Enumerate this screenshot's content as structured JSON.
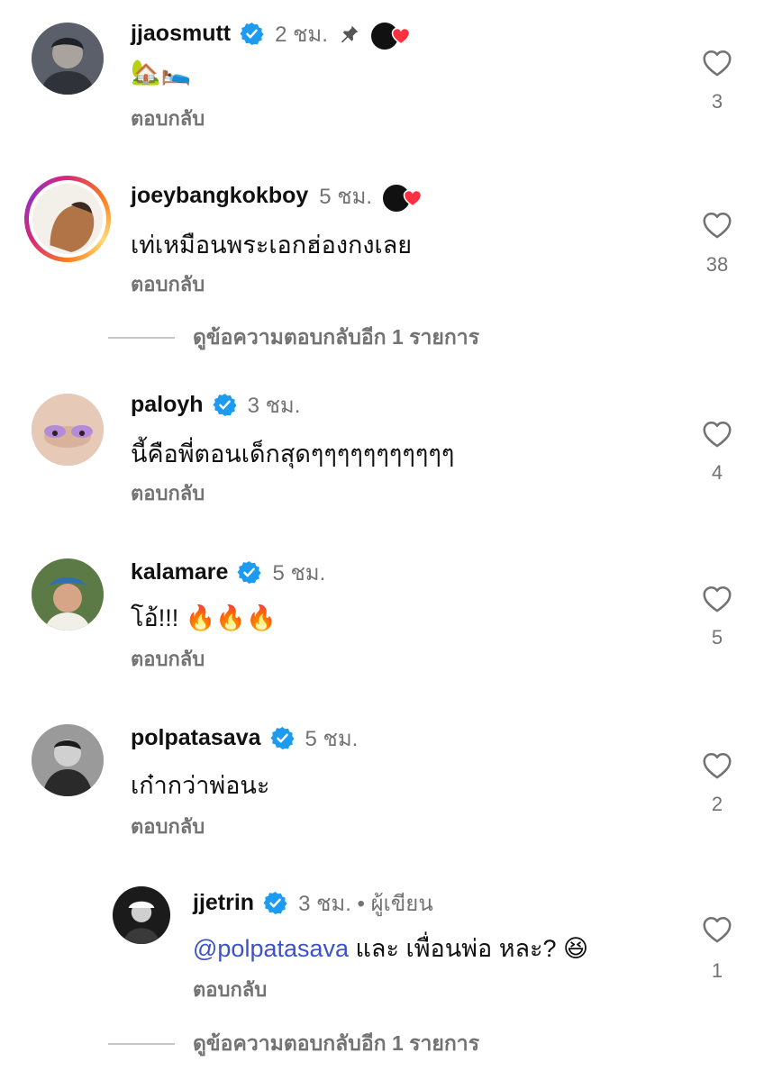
{
  "comments": [
    {
      "username": "jjaosmutt",
      "time": "2 ชม.",
      "text": "🏡🛌",
      "reply_label": "ตอบกลับ",
      "likes": "3"
    },
    {
      "username": "joeybangkokboy",
      "time": "5 ชม.",
      "text": "เท่เหมือนพระเอกฮ่องกงเลย",
      "reply_label": "ตอบกลับ",
      "likes": "38",
      "view_more": "ดูข้อความตอบกลับอีก 1 รายการ"
    },
    {
      "username": "paloyh",
      "time": "3 ชม.",
      "text": "นี้คือพี่ตอนเด็กสุดๆๆๆๆๆๆๆๆๆๆๆ",
      "reply_label": "ตอบกลับ",
      "likes": "4"
    },
    {
      "username": "kalamare",
      "time": "5 ชม.",
      "text": "โอ้!!! 🔥🔥🔥",
      "reply_label": "ตอบกลับ",
      "likes": "5"
    },
    {
      "username": "polpatasava",
      "time": "5 ชม.",
      "text": "เก๋ากว่าพ่อนะ",
      "reply_label": "ตอบกลับ",
      "likes": "2"
    },
    {
      "username": "jjetrin",
      "time": "3 ชม. • ผู้เขียน",
      "mention": "@polpatasava",
      "text": " และ เพื่อนพ่อ หละ? 😆",
      "reply_label": "ตอบกลับ",
      "likes": "1",
      "view_more": "ดูข้อความตอบกลับอีก 1 รายการ"
    }
  ],
  "icons": {
    "verified": "verified-badge-icon",
    "pin": "pin-icon",
    "like": "heart-outline-icon",
    "liked_by_author": "author-liked-heart-icon"
  },
  "colors": {
    "verified": "#1d9bf0",
    "heart": "#ff3040",
    "mention": "#3b52c9",
    "muted": "#737373"
  }
}
